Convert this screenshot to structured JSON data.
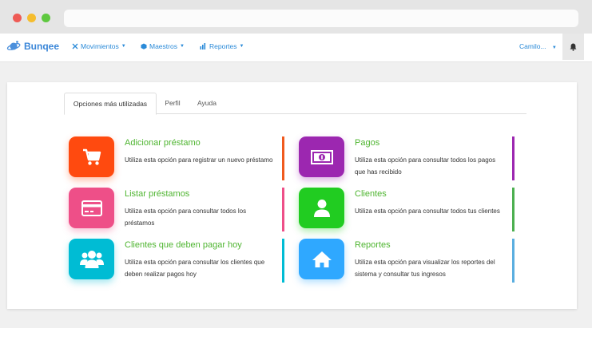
{
  "brand": {
    "name": "Bunqee"
  },
  "nav": {
    "menus": [
      {
        "label": "Movimientos"
      },
      {
        "label": "Maestros"
      },
      {
        "label": "Reportes"
      }
    ],
    "user": "Camilo..."
  },
  "tabs": [
    {
      "label": "Opciones más utilizadas"
    },
    {
      "label": "Perfil"
    },
    {
      "label": "Ayuda"
    }
  ],
  "options": [
    {
      "title": "Adicionar préstamo",
      "desc": "Utiliza esta opción para registrar un nuevo préstamo",
      "color": "#ff4a0f",
      "line": "#f05a1e",
      "icon": "cart-icon"
    },
    {
      "title": "Pagos",
      "desc": "Utiliza esta opción para consultar todos los pagos que has recibido",
      "color": "#9c27b0",
      "line": "#9c27b0",
      "icon": "money-icon"
    },
    {
      "title": "Listar préstamos",
      "desc": "Utiliza esta opción para consultar todos los préstamos",
      "color": "#ee4f88",
      "line": "#ee4f88",
      "icon": "credit-card-icon"
    },
    {
      "title": "Clientes",
      "desc": "Utiliza esta opción para consultar todos tus clientes",
      "color": "#21cc21",
      "line": "#4caf50",
      "icon": "user-icon"
    },
    {
      "title": "Clientes que deben pagar hoy",
      "desc": "Utiliza esta opción para consultar los clientes que deben realizar pagos hoy",
      "color": "#00bcd4",
      "line": "#00bcd4",
      "icon": "users-icon"
    },
    {
      "title": "Reportes",
      "desc": "Utiliza esta opción para visualizar los reportes del sistema y consultar tus ingresos",
      "color": "#2fa8ff",
      "line": "#5aaee0",
      "icon": "home-icon"
    }
  ]
}
